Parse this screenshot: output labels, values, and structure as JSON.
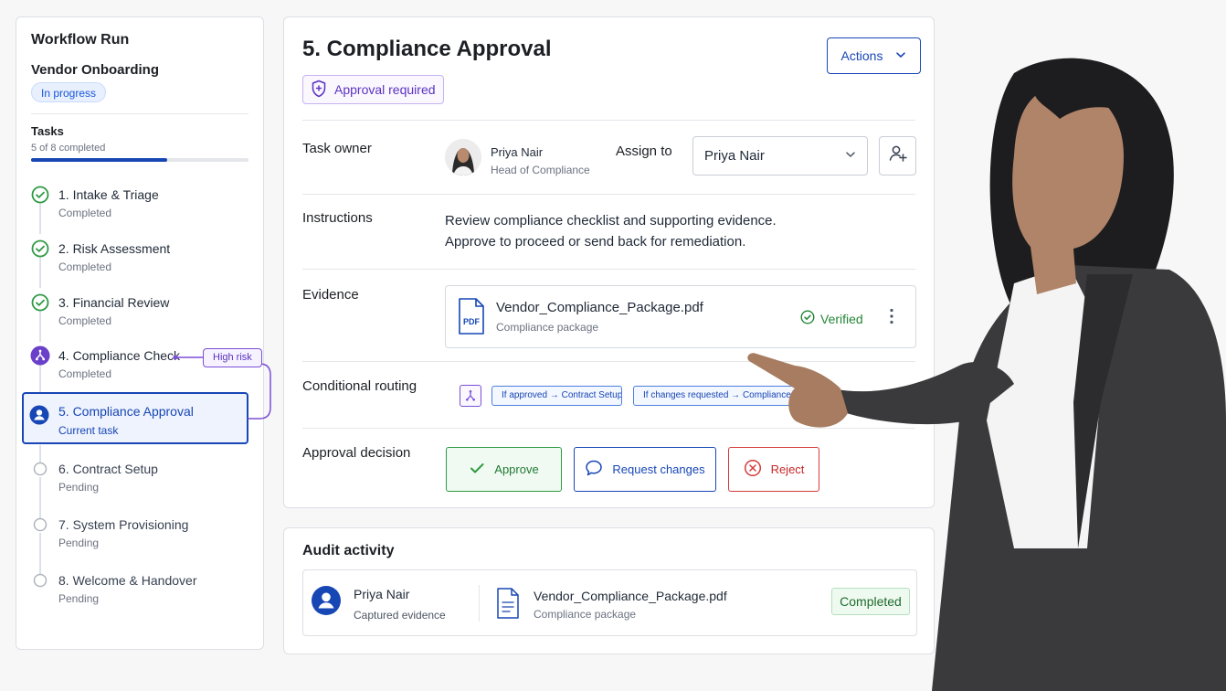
{
  "sidebar": {
    "title": "Workflow Run",
    "workflow_name": "Vendor Onboarding",
    "status_badge": "In progress",
    "tasks_label": "Tasks",
    "progress_text": "5 of 8 completed",
    "progress_fraction": 0.625,
    "tasks": [
      {
        "label": "1. Intake & Triage",
        "status": "Completed",
        "state": "done"
      },
      {
        "label": "2. Risk Assessment",
        "status": "Completed",
        "state": "done"
      },
      {
        "label": "3. Financial Review",
        "status": "Completed",
        "state": "done"
      },
      {
        "label": "4. Compliance Check",
        "status": "Completed",
        "state": "branch"
      },
      {
        "label": "5. Compliance Approval",
        "status": "Current task",
        "state": "current"
      },
      {
        "label": "6. Contract Setup",
        "status": "Pending",
        "state": "pending"
      },
      {
        "label": "7. System Provisioning",
        "status": "Pending",
        "state": "pending"
      },
      {
        "label": "8. Welcome & Handover",
        "status": "Pending",
        "state": "pending"
      }
    ],
    "risk_chip": "High risk"
  },
  "main": {
    "title": "5. Compliance Approval",
    "actions_label": "Actions",
    "approval_chip": "Approval required",
    "task_owner_label": "Task owner",
    "owner_name": "Priya Nair",
    "owner_role": "Head of Compliance",
    "assign_label": "Assign to",
    "assign_value": "Priya Nair",
    "instructions_label": "Instructions",
    "instructions_line1": "Review compliance checklist and supporting evidence.",
    "instructions_line2": "Approve to proceed or send back for remediation.",
    "evidence_label": "Evidence",
    "evidence_file": "Vendor_Compliance_Package.pdf",
    "evidence_sub": "Compliance package",
    "evidence_pdf_tag": "PDF",
    "evidence_status": "Verified",
    "routing_label": "Conditional routing",
    "route_approved": "If approved → Contract Setup",
    "route_changes": "If changes requested → Compliance Check",
    "decision_label": "Approval decision",
    "approve": "Approve",
    "request_changes": "Request changes",
    "reject": "Reject"
  },
  "audit": {
    "title": "Audit activity",
    "actor": "Priya Nair",
    "action": "Captured evidence",
    "file": "Vendor_Compliance_Package.pdf",
    "file_sub": "Compliance package",
    "status": "Completed"
  },
  "colors": {
    "primary": "#1746b5",
    "success": "#238636",
    "danger": "#d63a3a",
    "branch_purple": "#7b4fd6"
  }
}
